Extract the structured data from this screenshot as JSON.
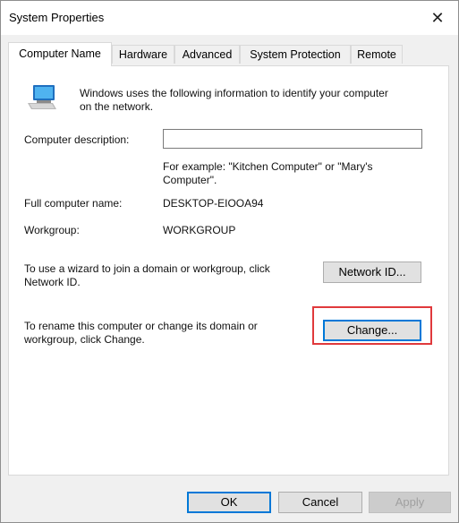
{
  "window": {
    "title": "System Properties",
    "close_glyph": "✕"
  },
  "tabs": [
    {
      "label": "Computer Name",
      "active": true
    },
    {
      "label": "Hardware",
      "active": false
    },
    {
      "label": "Advanced",
      "active": false
    },
    {
      "label": "System Protection",
      "active": false
    },
    {
      "label": "Remote",
      "active": false
    }
  ],
  "computer_name": {
    "intro_line1": "Windows uses the following information to identify your computer",
    "intro_line2": "on the network.",
    "description_label": "Computer description:",
    "description_value": "",
    "example_line1": "For example: \"Kitchen Computer\" or \"Mary's",
    "example_line2": "Computer\".",
    "full_name_label": "Full computer name:",
    "full_name_value": "DESKTOP-EIOOA94",
    "workgroup_label": "Workgroup:",
    "workgroup_value": "WORKGROUP",
    "network_text_line1": "To use a wizard to join a domain or workgroup, click",
    "network_text_line2": "Network ID.",
    "network_id_button": "Network ID...",
    "rename_text_line1": "To rename this computer or change its domain or",
    "rename_text_line2": "workgroup, click Change.",
    "change_button": "Change..."
  },
  "footer": {
    "ok_button": "OK",
    "cancel_button": "Cancel",
    "apply_button": "Apply"
  },
  "colors": {
    "highlight_outline": "#e0393c",
    "default_button_border": "#0078d7"
  },
  "icons": {
    "window_close": "close-icon",
    "computer": "computer-icon"
  }
}
